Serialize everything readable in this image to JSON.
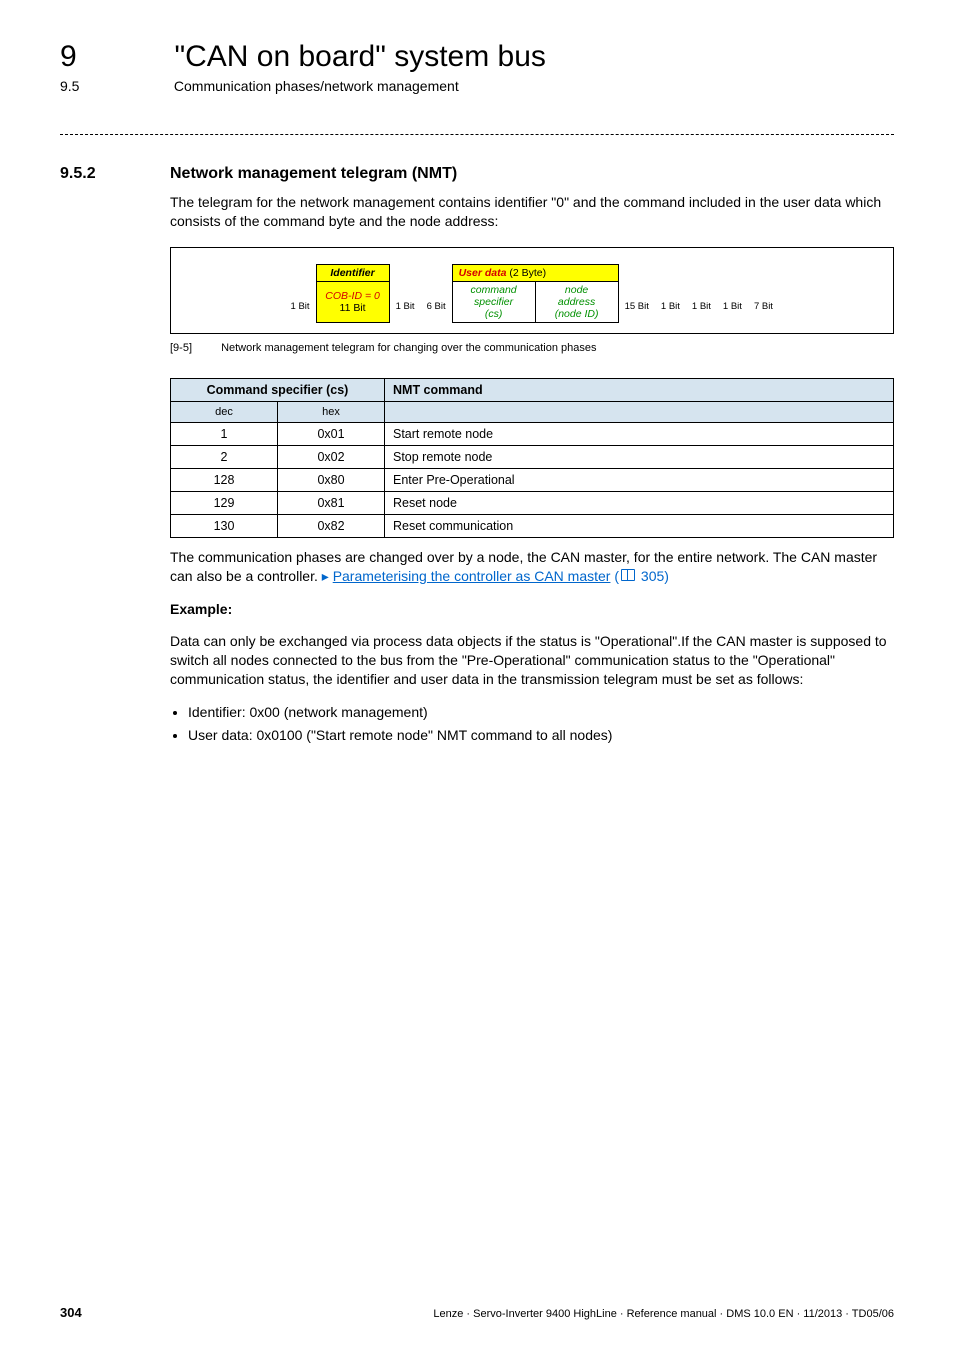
{
  "header": {
    "chapter_number": "9",
    "chapter_title": "\"CAN on board\" system bus",
    "section_number": "9.5",
    "section_title": "Communication phases/network management"
  },
  "heading": {
    "number": "9.5.2",
    "title": "Network management telegram (NMT)"
  },
  "intro_para": "The telegram for the network management contains identifier \"0\" and the command included in the user data which consists of the command byte and the node address:",
  "telegram": {
    "row1": {
      "identifier": "Identifier",
      "userdata": "User data",
      "userdata_bytes": " (2 Byte)"
    },
    "row2": {
      "cobid": "COB-ID = 0",
      "command_specifier_l1": "command",
      "command_specifier_l2": "specifier",
      "command_specifier_l3": "(cs)",
      "nodeaddr_l1": "node",
      "nodeaddr_l2": "address",
      "nodeaddr_l3": "(node ID)"
    },
    "bits": {
      "b0": "1 Bit",
      "b1": "11 Bit",
      "b2": "1 Bit",
      "b3": "6 Bit",
      "b4": "15 Bit",
      "b5": "1 Bit",
      "b6": "1 Bit",
      "b7": "1 Bit",
      "b8": "7 Bit"
    }
  },
  "caption": {
    "tag": "[9-5]",
    "text": "Network management telegram for changing over the communication phases"
  },
  "nmt_table": {
    "header_cs": "Command specifier (cs)",
    "header_cmd": "NMT command",
    "sub_dec": "dec",
    "sub_hex": "hex",
    "rows": [
      {
        "dec": "1",
        "hex": "0x01",
        "cmd": "Start remote node"
      },
      {
        "dec": "2",
        "hex": "0x02",
        "cmd": "Stop remote node"
      },
      {
        "dec": "128",
        "hex": "0x80",
        "cmd": "Enter Pre-Operational"
      },
      {
        "dec": "129",
        "hex": "0x81",
        "cmd": "Reset node"
      },
      {
        "dec": "130",
        "hex": "0x82",
        "cmd": "Reset communication"
      }
    ]
  },
  "after_table_para_pre": "The communication phases are changed over by a node, the CAN master, for the entire network. The CAN master can also be a controller.  ",
  "after_table_link_text": "Parameterising the controller as CAN master",
  "after_table_pageref": " 305)",
  "example_heading": "Example:",
  "example_para": "Data can only be exchanged via process data objects if the status is \"Operational\".If the CAN master is supposed to switch all nodes connected to the bus from the \"Pre-Operational\" communication status to the \"Operational\" communication status, the identifier and user data in the transmission telegram must be set as follows:",
  "bullets": [
    "Identifier: 0x00 (network management)",
    "User data: 0x0100 (\"Start remote node\" NMT command to all nodes)"
  ],
  "footer": {
    "page": "304",
    "right": "Lenze · Servo-Inverter 9400 HighLine · Reference manual · DMS 10.0 EN · 11/2013 · TD05/06"
  }
}
